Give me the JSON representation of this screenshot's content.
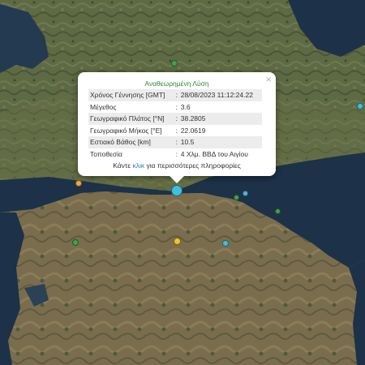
{
  "popup": {
    "title": "Αναθεωρημένη Λύση",
    "rows": [
      {
        "label": "Χρόνος Γέννησης [GMT]",
        "value": "28/08/2023 11:12:24.22"
      },
      {
        "label": "Μέγεθος",
        "value": "3.6"
      },
      {
        "label": "Γεωγραφικό Πλάτος [°N]",
        "value": "38.2805"
      },
      {
        "label": "Γεωγραφικό Μήκος [°E]",
        "value": "22.0619"
      },
      {
        "label": "Εστιακό Βάθος [km]",
        "value": "10.5"
      },
      {
        "label": "Τοποθεσία",
        "value": "4 Χλμ. ΒΒΔ του Αιγίου"
      }
    ],
    "more_prefix": "Κάντε ",
    "more_link": "κλικ",
    "more_suffix": " για περισσότερες πληροφορίες",
    "close_symbol": "×"
  },
  "colors": {
    "land": "#5d6a44",
    "sea": "#1d3148",
    "popup_title": "#2f8a2f",
    "link": "#2a7fc0",
    "marker_cyan": "#3fc0dc",
    "marker_green": "#3fa34a",
    "marker_yellow": "#f2c230",
    "marker_orange": "#f2a83a"
  },
  "icons": {
    "close": "close-icon"
  }
}
